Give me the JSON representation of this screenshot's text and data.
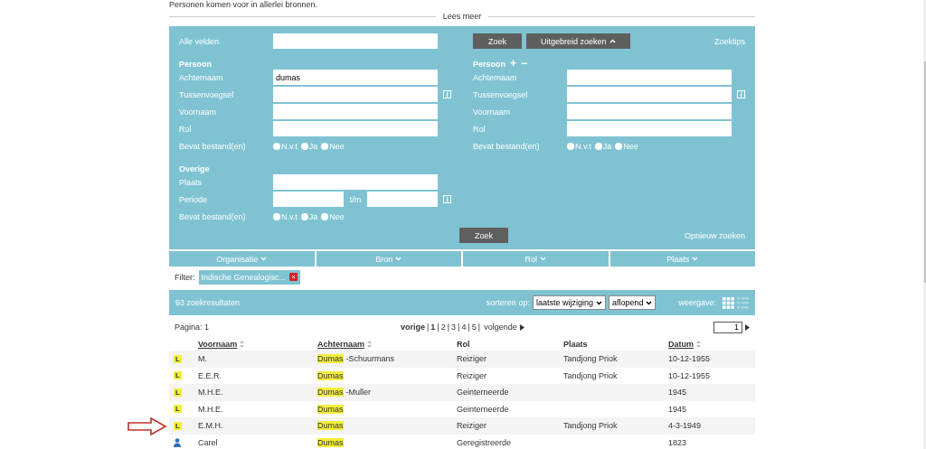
{
  "intro": "Personen komen voor in allerlei bronnen.",
  "read_more": "Lees meer",
  "search": {
    "all_fields": {
      "label": "Alle velden"
    },
    "search_button": "Zoek",
    "advanced_button": "Uitgebreid zoeken",
    "advanced_expanded": true,
    "tips_link": "Zoektips",
    "person_groups": [
      {
        "heading": "Persoon",
        "fields": [
          {
            "label": "Achternaam",
            "value": "dumas",
            "info": false
          },
          {
            "label": "Tussenvoegsel",
            "info": true
          },
          {
            "label": "Voornaam",
            "info": false
          },
          {
            "label": "Rol",
            "info": false
          }
        ],
        "files": {
          "label": "Bevat bestand(en)",
          "options": [
            {
              "label": "N.v.t",
              "selected": false
            },
            {
              "label": "Ja",
              "selected": false
            },
            {
              "label": "Nee",
              "selected": false
            }
          ]
        }
      },
      {
        "heading": "Persoon",
        "add": "+",
        "remove": "−",
        "fields": [
          {
            "label": "Achternaam",
            "info": false
          },
          {
            "label": "Tussenvoegsel",
            "info": true
          },
          {
            "label": "Voornaam",
            "info": false
          },
          {
            "label": "Rol",
            "info": false
          }
        ],
        "files": {
          "label": "Bevat bestand(en)",
          "options": [
            {
              "label": "N.v.t",
              "selected": false
            },
            {
              "label": "Ja",
              "selected": false
            },
            {
              "label": "Nee",
              "selected": false
            }
          ]
        }
      }
    ],
    "other": {
      "heading": "Overige",
      "place": {
        "label": "Plaats"
      },
      "period": {
        "label": "Periode",
        "separator": "t/m",
        "info": true
      },
      "files": {
        "label": "Bevat bestand(en)",
        "options": [
          {
            "label": "N.v.t",
            "selected": false
          },
          {
            "label": "Ja",
            "selected": false
          },
          {
            "label": "Nee",
            "selected": false
          }
        ]
      }
    },
    "bottom_button": "Zoek",
    "reset_link": "Opnieuw zoeken"
  },
  "facets": [
    {
      "label": "Organisatie"
    },
    {
      "label": "Bron"
    },
    {
      "label": "Rol"
    },
    {
      "label": "Plaats"
    }
  ],
  "filter": {
    "label": "Filter:",
    "chips": [
      {
        "label": "Indische Genealogisc..."
      }
    ]
  },
  "results": {
    "count": "93 zoekresultaten",
    "sort_label": "sorteren op:",
    "sort_field": "laatste wijziging",
    "sort_order": "aflopend",
    "view_label": "weergave:",
    "views": [
      {
        "kind": "grid",
        "selected": true
      },
      {
        "kind": "list",
        "selected": false
      }
    ]
  },
  "pager": {
    "page_label": "Pagina: 1",
    "prev": "vorige",
    "pages": [
      {
        "label": "1",
        "selected": true
      },
      {
        "label": "2",
        "selected": false
      },
      {
        "label": "3",
        "selected": false
      },
      {
        "label": "4",
        "selected": false
      },
      {
        "label": "5",
        "selected": false
      }
    ],
    "separator": "|",
    "next": "volgende",
    "page_input": "1"
  },
  "table": {
    "columns": [
      {
        "label": "Voornaam",
        "sortable": true
      },
      {
        "label": "Achternaam",
        "sortable": true
      },
      {
        "label": "Rol",
        "sortable": false
      },
      {
        "label": "Plaats",
        "sortable": false
      },
      {
        "label": "Datum",
        "sortable": true
      }
    ],
    "rows": [
      {
        "kind": "letter",
        "badge": "L",
        "first": "M.",
        "surname": {
          "match": "Dumas",
          "rest": "-Schuurmans"
        },
        "role": "Reiziger",
        "place": "Tandjong Priok",
        "date": "10-12-1955",
        "marked": false
      },
      {
        "kind": "letter",
        "badge": "L",
        "first": "E.E.R.",
        "surname": {
          "match": "Dumas"
        },
        "role": "Reiziger",
        "place": "Tandjong Priok",
        "date": "10-12-1955",
        "marked": false
      },
      {
        "kind": "letter",
        "badge": "L",
        "first": "M.H.E.",
        "surname": {
          "match": "Dumas",
          "rest": "-Muller"
        },
        "role": "Geinterneerde",
        "date": "1945",
        "marked": false
      },
      {
        "kind": "letter",
        "badge": "L",
        "first": "M.H.E.",
        "surname": {
          "match": "Dumas"
        },
        "role": "Geinterneerde",
        "date": "1945",
        "marked": false
      },
      {
        "kind": "letter",
        "badge": "L",
        "first": "E.M.H.",
        "surname": {
          "match": "Dumas"
        },
        "role": "Reiziger",
        "place": "Tandjong Priok",
        "date": "4-3-1949",
        "marked": true
      },
      {
        "kind": "person",
        "first": "Carel",
        "surname": {
          "match": "Dumas"
        },
        "role": "Geregistreerde",
        "date": "1823",
        "marked": false
      }
    ]
  }
}
